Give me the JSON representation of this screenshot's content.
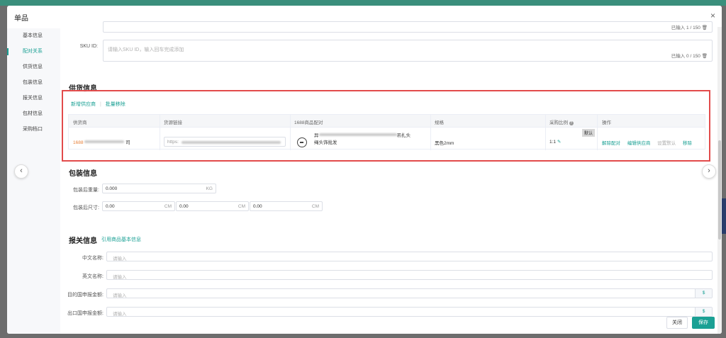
{
  "modal": {
    "title": "单品",
    "close": "×"
  },
  "sidebar": {
    "items": [
      {
        "label": "基本信息"
      },
      {
        "label": "配对关系"
      },
      {
        "label": "供货信息"
      },
      {
        "label": "包装信息"
      },
      {
        "label": "报关信息"
      },
      {
        "label": "包材信息"
      },
      {
        "label": "采购档口"
      }
    ]
  },
  "top_textarea": {
    "count": "已输入 1 / 150"
  },
  "sku": {
    "label": "SKU ID:",
    "placeholder": "请输入SKU ID，输入回车完成添加",
    "count": "已输入 0 / 150"
  },
  "supply": {
    "title": "供货信息",
    "add_supplier": "新增供应商",
    "divider": "|",
    "batch_remove": "批量移除",
    "columns": [
      "供货商",
      "货源链接",
      "1688商品配对",
      "规格",
      "采购比例",
      "操作"
    ],
    "row": {
      "supplier_prefix": "1688",
      "supplier_suffix": "司",
      "url_prefix": "https:",
      "product_line1_start": "异",
      "product_line1_end": "吊扎头",
      "product_line2": "绳头饰批发",
      "spec": "黑色2mm",
      "ratio": "1:1",
      "default_tag": "默认",
      "actions": [
        "解除配对",
        "编辑供应商",
        "设置默认",
        "移除"
      ]
    }
  },
  "packaging": {
    "title": "包装信息",
    "weight_label": "包装后重量:",
    "weight_value": "0.000",
    "weight_unit": "KG",
    "size_label": "包装后尺寸:",
    "dims": [
      {
        "value": "0.00",
        "unit": "CM"
      },
      {
        "value": "0.00",
        "unit": "CM"
      },
      {
        "value": "0.00",
        "unit": "CM"
      }
    ]
  },
  "customs": {
    "title": "报关信息",
    "cite_link": "引用商品基本信息",
    "fields": [
      {
        "label": "中文名称:",
        "placeholder": "请输入"
      },
      {
        "label": "英文名称:",
        "placeholder": "请输入"
      },
      {
        "label": "目的国申报金额:",
        "placeholder": "请输入",
        "addon": "$"
      },
      {
        "label": "出口国申报金额:",
        "placeholder": "请输入",
        "addon": "$"
      }
    ]
  },
  "footer": {
    "close": "关闭",
    "save": "保存"
  },
  "nav": {
    "prev": "‹",
    "next": "›"
  },
  "colors": {
    "accent": "#1aa094",
    "highlight_box": "#e24b4b",
    "supplier_text": "#e8823a"
  }
}
